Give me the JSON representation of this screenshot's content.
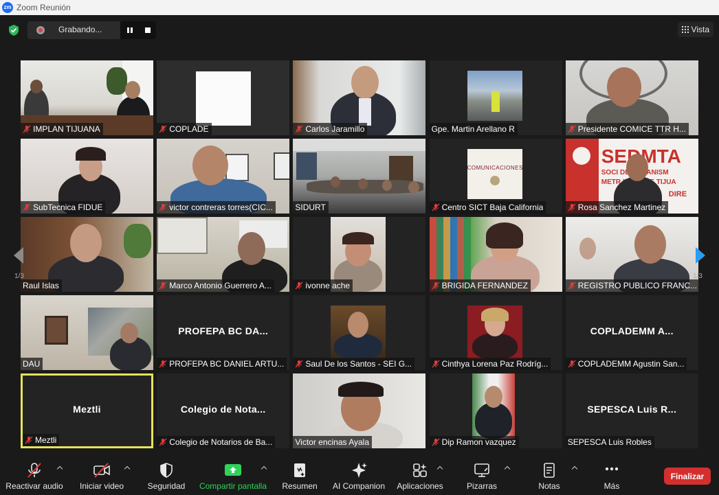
{
  "window": {
    "title": "Zoom Reunión",
    "logo_text": "zm"
  },
  "recording": {
    "label": "Grabando..."
  },
  "view_button": {
    "label": "Vista"
  },
  "pager": {
    "left": "1/3",
    "right": "1/3"
  },
  "tiles": [
    {
      "name": "IMPLAN TIJUANA",
      "muted": true
    },
    {
      "name": "COPLADE",
      "muted": true
    },
    {
      "name": "Carlos Jaramillo",
      "muted": true
    },
    {
      "name": "Gpe. Martin Arellano R",
      "muted": false,
      "speaking": true
    },
    {
      "name": "Presidente COMICE TTR  H...",
      "muted": true
    },
    {
      "name": "SubTecnica FIDUE",
      "muted": true
    },
    {
      "name": "victor contreras torres(CIC...",
      "muted": true
    },
    {
      "name": "SIDURT",
      "muted": false
    },
    {
      "name": "Centro SICT Baja California",
      "muted": true
    },
    {
      "name": "Rosa Sanchez Martinez",
      "muted": true
    },
    {
      "name": "Raul Islas",
      "muted": false
    },
    {
      "name": "Marco Antonio Guerrero A...",
      "muted": true
    },
    {
      "name": "ivonne ache",
      "muted": true
    },
    {
      "name": "BRIGIDA FERNANDEZ",
      "muted": true
    },
    {
      "name": "REGISTRO PUBLICO FRANC...",
      "muted": true
    },
    {
      "name": "DAU",
      "muted": false
    },
    {
      "name": "PROFEPA BC DANIEL ARTU...",
      "muted": true,
      "big_name": "PROFEPA BC DA..."
    },
    {
      "name": "Saul De los Santos - SEI  G...",
      "muted": true
    },
    {
      "name": "Cinthya Lorena Paz Rodríg...",
      "muted": true
    },
    {
      "name": "COPLADEMM Agustin San...",
      "muted": true,
      "big_name": "COPLADEMM A..."
    },
    {
      "name": "Meztli",
      "muted": true,
      "big_name": "Meztli",
      "active": true
    },
    {
      "name": "Colegio de Notarios de Ba...",
      "muted": true,
      "big_name": "Colegio de Nota..."
    },
    {
      "name": "Victor encinas Ayala",
      "muted": false
    },
    {
      "name": "Dip Ramon vazquez",
      "muted": true
    },
    {
      "name": "SEPESCA Luis Robles",
      "muted": false,
      "big_name": "SEPESCA Luis R...",
      "speaking": true
    }
  ],
  "tile_text": {
    "comunicaciones": "COMUNICACIONES",
    "sedumta_big": "SEDMTA",
    "sedumta_small1": "SOCI    DE URBANISM",
    "sedumta_small2": "METR   ITANA DE TIJUA",
    "sedumta_small3": "DIRE"
  },
  "toolbar": {
    "audio": "Reactivar audio",
    "video": "Iniciar video",
    "security": "Seguridad",
    "share": "Compartir pantalla",
    "summary": "Resumen",
    "companion": "AI Companion",
    "apps": "Aplicaciones",
    "whiteboards": "Pizarras",
    "notes": "Notas",
    "more": "Más",
    "end": "Finalizar"
  },
  "colors": {
    "accent_share": "#2fd35a",
    "end_red": "#d42f2f",
    "speaking_yellow": "#e6e35a",
    "nav_blue": "#2a9df4",
    "mute_red": "#e03d3d"
  }
}
